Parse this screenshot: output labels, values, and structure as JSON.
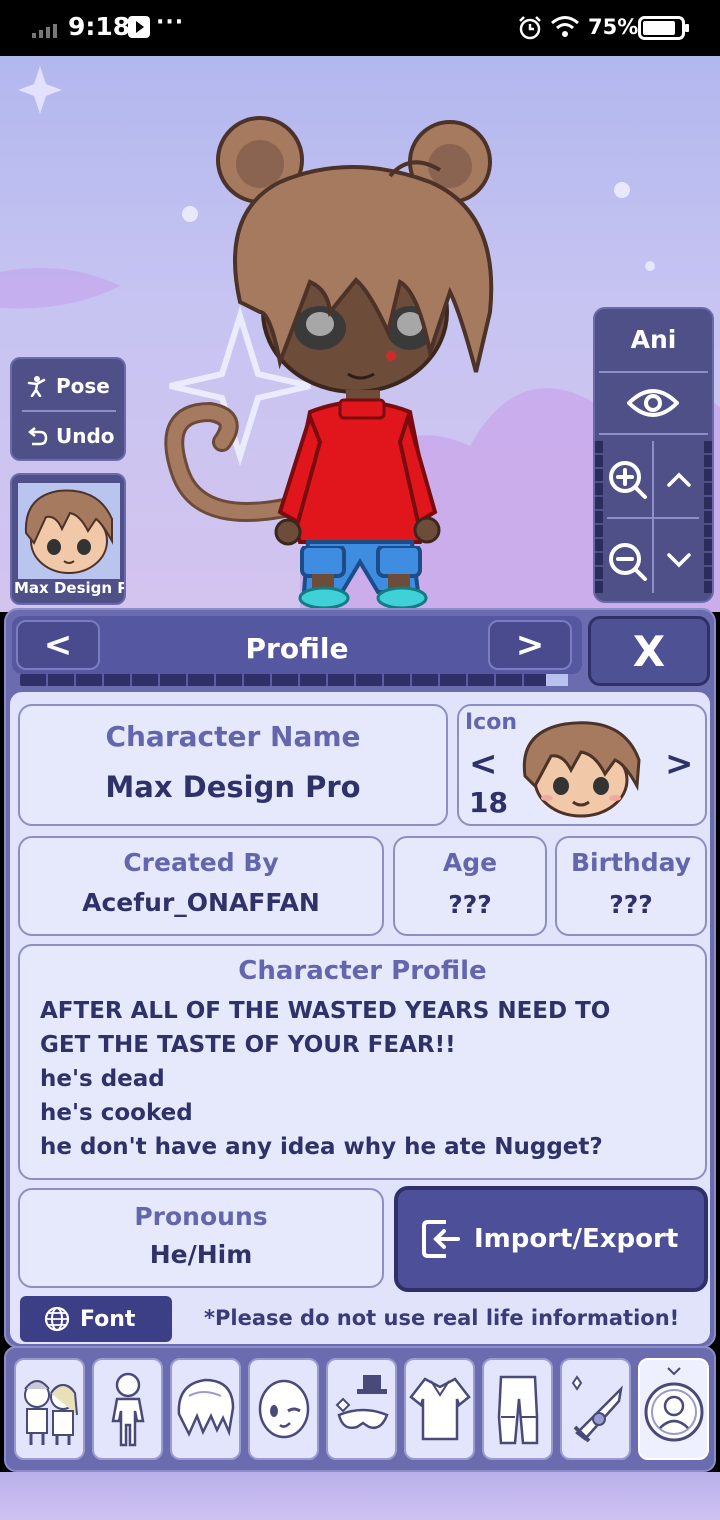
{
  "status_bar": {
    "time": "9:18",
    "dots": "···",
    "battery": "75%"
  },
  "side_panel": {
    "pose_label": "Pose",
    "undo_label": "Undo",
    "character_thumb_name": "Max Design Pr"
  },
  "ani_panel": {
    "ani_label": "Ani"
  },
  "profile_header": {
    "prev": "<",
    "title": "Profile",
    "next": ">",
    "close": "X",
    "progress": 0.96
  },
  "profile": {
    "character_name_label": "Character Name",
    "character_name": "Max Design Pro",
    "icon_label": "Icon",
    "icon_prev": "<",
    "icon_next": ">",
    "icon_number": "18",
    "created_by_label": "Created By",
    "created_by": "Acefur_ONAFFAN",
    "age_label": "Age",
    "age": "???",
    "birthday_label": "Birthday",
    "birthday": "???",
    "character_profile_label": "Character Profile",
    "character_profile_lines": [
      "AFTER ALL OF THE WASTED YEARS NEED TO",
      "GET THE TASTE OF YOUR FEAR!!",
      "he's dead",
      "he's cooked",
      "he don't have any idea why he ate Nugget?"
    ],
    "pronouns_label": "Pronouns",
    "pronouns": "He/Him",
    "import_export_label": "Import/Export",
    "font_label": "Font",
    "disclaimer": "*Please do not use real life information!"
  },
  "tabs": [
    {
      "icon": "characters-icon"
    },
    {
      "icon": "body-icon"
    },
    {
      "icon": "hair-icon"
    },
    {
      "icon": "face-icon"
    },
    {
      "icon": "accessory-icon"
    },
    {
      "icon": "clothing-top-icon"
    },
    {
      "icon": "clothing-bottom-icon"
    },
    {
      "icon": "props-icon"
    },
    {
      "icon": "profile-icon",
      "active": true
    }
  ],
  "colors": {
    "panel": "#6b6caf",
    "panel_dark": "#4f5088",
    "label_text": "#6466ad",
    "value_text": "#2f3169",
    "shirt": "#e0161c",
    "pants": "#3f8de0",
    "hair": "#a57a5e"
  }
}
